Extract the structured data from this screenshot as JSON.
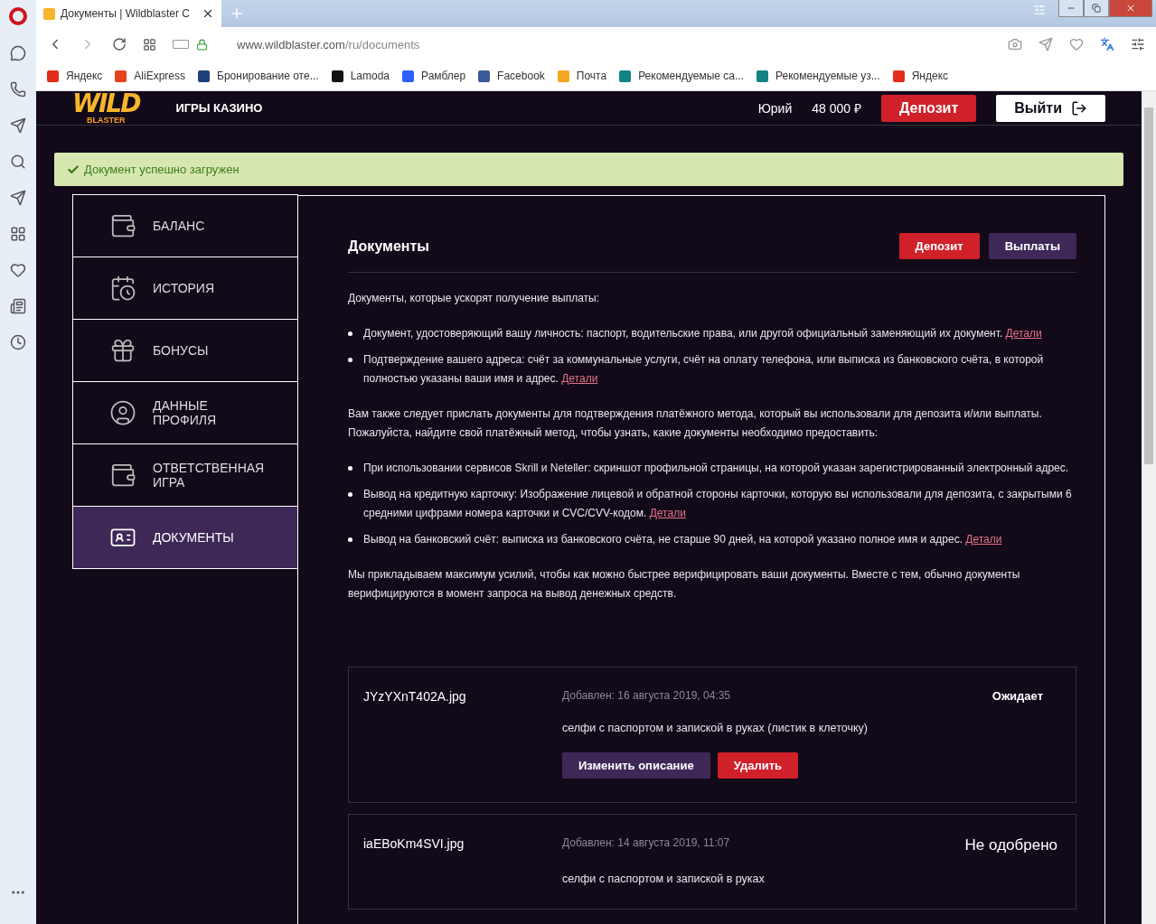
{
  "browser": {
    "tab_title": "Документы | Wildblaster C",
    "url_host": "www.wildblaster.com",
    "url_path": "/ru/documents",
    "bookmarks": [
      {
        "label": "Яндекс",
        "color": "#e32d1c"
      },
      {
        "label": "AliExpress",
        "color": "#e8411e"
      },
      {
        "label": "Бронирование оте...",
        "color": "#1f3f7a"
      },
      {
        "label": "Lamoda",
        "color": "#111111"
      },
      {
        "label": "Рамблер",
        "color": "#315efb"
      },
      {
        "label": "Facebook",
        "color": "#3b5998"
      },
      {
        "label": "Почта",
        "color": "#f5a623"
      },
      {
        "label": "Рекомендуемые са...",
        "color": "#138484"
      },
      {
        "label": "Рекомендуемые уз...",
        "color": "#138484"
      },
      {
        "label": "Яндекс",
        "color": "#e32d1c"
      }
    ]
  },
  "header": {
    "logo_word": "WILD",
    "logo_sub": "BLASTER",
    "nav": "ИГРЫ КАЗИНО",
    "user": "Юрий",
    "balance": "48 000 ₽",
    "deposit": "Депозит",
    "logout": "Выйти"
  },
  "alert": "Документ успешно загружен",
  "menu": [
    {
      "label": "БАЛАНС",
      "selected": false
    },
    {
      "label": "ИСТОРИЯ",
      "selected": false
    },
    {
      "label": "БОНУСЫ",
      "selected": false
    },
    {
      "label": "ДАННЫЕ ПРОФИЛЯ",
      "selected": false
    },
    {
      "label": "ОТВЕТСТВЕННАЯ ИГРА",
      "selected": false
    },
    {
      "label": "ДОКУМЕНТЫ",
      "selected": true
    }
  ],
  "content": {
    "title": "Документы",
    "buttons": [
      {
        "label": "Депозит",
        "kind": "primary"
      },
      {
        "label": "Выплаты",
        "kind": "secondary"
      }
    ],
    "blocks": [
      {
        "kind": "paragraph",
        "text": "Документы, которые ускорят получение выплаты:"
      },
      {
        "kind": "list",
        "items": [
          {
            "text": "Документ, удостоверяющий вашу личность: паспорт, водительские права, или другой официальный заменяющий их документ.",
            "link": "Детали"
          },
          {
            "text": "Подтверждение вашего адреса: счёт за коммунальные услуги, счёт на оплату телефона, или выписка из банковского счёта, в которой полностью указаны ваши имя и адрес.",
            "link": "Детали"
          }
        ]
      },
      {
        "kind": "paragraph",
        "text": "Вам также следует прислать документы для подтверждения платёжного метода, который вы использовали для депозита и/или выплаты. Пожалуйста, найдите свой платёжный метод, чтобы узнать, какие документы необходимо предоставить:"
      },
      {
        "kind": "list",
        "items": [
          {
            "text": "При использовании сервисов Skrill и Neteller: скриншот профильной страницы, на которой указан зарегистрированный электронный адрес."
          },
          {
            "text": "Вывод на кредитную карточку: Изображение лицевой и обратной стороны карточки, которую вы использовали для депозита, с закрытыми 6 средними цифрами номера карточки и CVC/CVV-кодом.",
            "link": "Детали"
          },
          {
            "text": "Вывод на банковский счёт: выписка из банковского счёта, не старше 90 дней, на которой указано полное имя и адрес.",
            "link": "Детали"
          }
        ]
      },
      {
        "kind": "paragraph",
        "text": "Мы прикладываем максимум усилий, чтобы как можно быстрее верифицировать ваши документы. Вместе с тем, обычно документы верифицируются в момент запроса на вывод денежных средств."
      }
    ],
    "documents": [
      {
        "file": "JYzYXnT402A.jpg",
        "added": "Добавлен: 16 августа 2019, 04:35",
        "status": "Ожидает",
        "kind": "pending",
        "description": "селфи с паспортом и запиской в руках (листик в клеточку)",
        "actions": [
          {
            "label": "Изменить описание",
            "kind": "secondary"
          },
          {
            "label": "Удалить",
            "kind": "primary"
          }
        ]
      },
      {
        "file": "iaEBoKm4SVI.jpg",
        "added": "Добавлен: 14 августа 2019, 11:07",
        "status": "Не одобрено",
        "kind": "rejected",
        "description": "селфи с паспортом и запиской в руках"
      }
    ]
  }
}
